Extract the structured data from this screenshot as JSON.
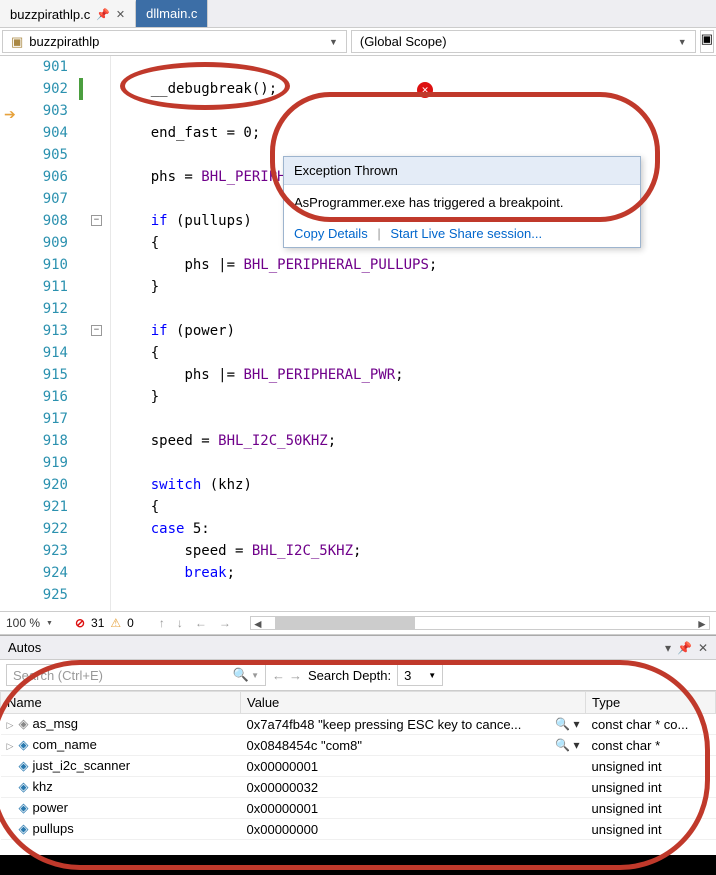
{
  "tabs": [
    {
      "label": "buzzpirathlp.c",
      "active": true
    },
    {
      "label": "dllmain.c",
      "active": false
    }
  ],
  "scope": {
    "left": "buzzpirathlp",
    "right": "(Global Scope)"
  },
  "line_numbers": [
    "901",
    "902",
    "903",
    "904",
    "905",
    "906",
    "907",
    "908",
    "909",
    "910",
    "911",
    "912",
    "913",
    "914",
    "915",
    "916",
    "917",
    "918",
    "919",
    "920",
    "921",
    "922",
    "923",
    "924",
    "925"
  ],
  "code_lines": [
    {
      "indent": "{"
    },
    {
      "fn": "__debugbreak",
      "suffix": "();"
    },
    {},
    {
      "var1": "end_fast",
      "rest": " = 0;"
    },
    {},
    {
      "var1": "phs",
      "eq": " = ",
      "const": "BHL_PERIPH",
      "suffix": "… ;"
    },
    {},
    {
      "kw": "if ",
      "var": "(pullups)"
    },
    {
      "indent": "{"
    },
    {
      "var1": "    phs |= ",
      "const": "BHL_PERIPHERAL_PULLUPS",
      "suffix": ";"
    },
    {
      "indent": "}"
    },
    {},
    {
      "kw": "if ",
      "var": "(power)"
    },
    {
      "indent": "{"
    },
    {
      "var1": "    phs |= ",
      "const": "BHL_PERIPHERAL_PWR",
      "suffix": ";"
    },
    {
      "indent": "}"
    },
    {},
    {
      "var1": "speed = ",
      "const": "BHL_I2C_50KHZ",
      "suffix": ";"
    },
    {},
    {
      "kw": "switch ",
      "var": "(khz)"
    },
    {
      "indent": "{"
    },
    {
      "kw": "case ",
      "var": "5:"
    },
    {
      "var1": "    speed = ",
      "const": "BHL_I2C_5KHZ",
      "suffix": ";"
    },
    {
      "kw": "    break",
      "suffix": ";"
    },
    {}
  ],
  "exception": {
    "title": "Exception Thrown",
    "message": "AsProgrammer.exe has triggered a breakpoint.",
    "link1": "Copy Details",
    "link2": "Start Live Share session..."
  },
  "toolbar": {
    "zoom": "100 %",
    "errors": "31",
    "warnings": "0"
  },
  "autos": {
    "title": "Autos",
    "search_placeholder": "Search (Ctrl+E)",
    "depth_label": "Search Depth:",
    "depth_value": "3",
    "columns": [
      "Name",
      "Value",
      "Type"
    ],
    "rows": [
      {
        "name": "as_msg",
        "value": "0x7a74fb48 \"keep pressing ESC key to cance...",
        "type": "const char * co...",
        "mag": true,
        "expander": true,
        "gray": true
      },
      {
        "name": "com_name",
        "value": "0x0848454c \"com8\"",
        "type": "const char *",
        "mag": true,
        "expander": true
      },
      {
        "name": "just_i2c_scanner",
        "value": "0x00000001",
        "type": "unsigned int"
      },
      {
        "name": "khz",
        "value": "0x00000032",
        "type": "unsigned int"
      },
      {
        "name": "power",
        "value": "0x00000001",
        "type": "unsigned int"
      },
      {
        "name": "pullups",
        "value": "0x00000000",
        "type": "unsigned int"
      }
    ]
  }
}
